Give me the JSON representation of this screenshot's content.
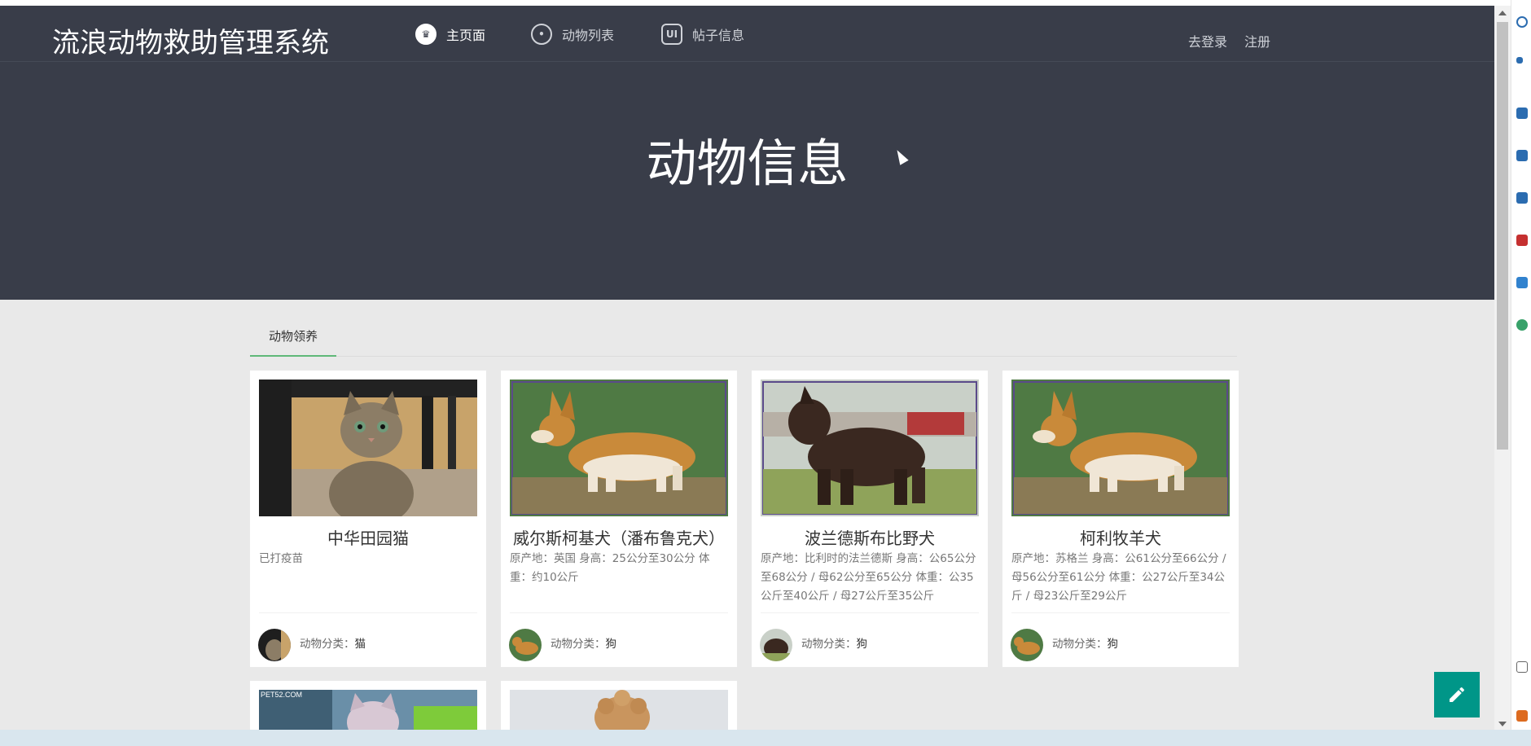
{
  "header": {
    "logo": "流浪动物救助管理系统",
    "nav": [
      {
        "label": "主页面",
        "icon": "crown-icon",
        "active": true
      },
      {
        "label": "动物列表",
        "icon": "pet-icon",
        "active": false
      },
      {
        "label": "帖子信息",
        "icon": "ui-icon",
        "active": false
      }
    ],
    "login": "去登录",
    "register": "注册"
  },
  "hero": {
    "title": "动物信息"
  },
  "tabs": [
    {
      "label": "动物领养",
      "active": true
    }
  ],
  "cards": [
    {
      "name": "中华田园猫",
      "desc": "已打疫苗",
      "category_label": "动物分类：",
      "category": "猫",
      "photo": "cat-photo"
    },
    {
      "name": "威尔斯柯基犬（潘布鲁克犬）",
      "desc": "原产地：英国 身高：25公分至30公分 体重：约10公斤",
      "category_label": "动物分类：",
      "category": "狗",
      "photo": "corgi-photo"
    },
    {
      "name": "波兰德斯布比野犬",
      "desc": "原产地：比利时的法兰德斯 身高：公65公分至68公分 / 母62公分至65公分 体重：公35公斤至40公斤 / 母27公斤至35公斤",
      "category_label": "动物分类：",
      "category": "狗",
      "photo": "bouvier-photo"
    },
    {
      "name": "柯利牧羊犬",
      "desc": "原产地：苏格兰 身高：公61公分至66公分 / 母56公分至61公分 体重：公27公斤至34公斤 / 母23公斤至29公斤",
      "category_label": "动物分类：",
      "category": "狗",
      "photo": "corgi-photo"
    }
  ],
  "partial_cards": [
    {
      "watermark": "PET52.COM",
      "photo": "kitten-photo"
    },
    {
      "photo": "poodle-photo"
    }
  ],
  "colors": {
    "header_bg": "#393d49",
    "tab_accent": "#5fb878",
    "fab": "#009688",
    "page_bg": "#e9e9e9"
  }
}
